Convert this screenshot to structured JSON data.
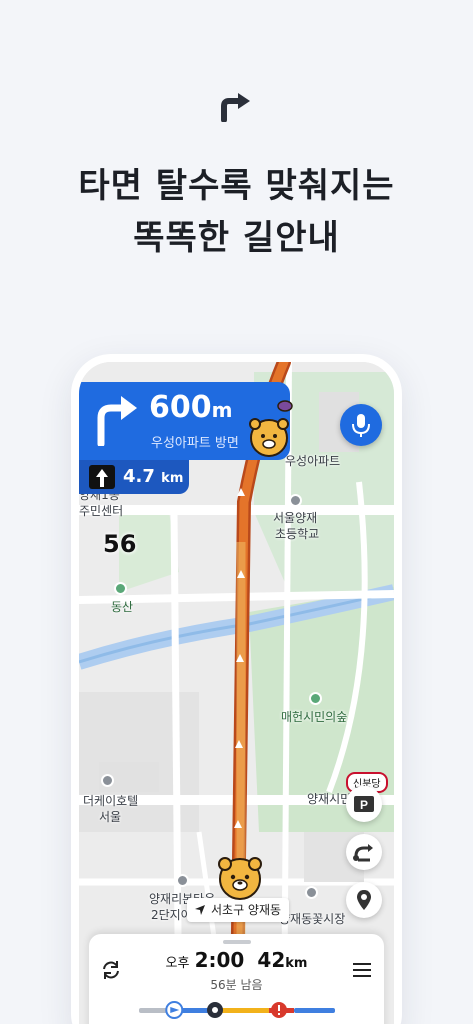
{
  "headline": {
    "line1": "타면 탈수록 맞춰지는",
    "line2": "똑똑한 길안내"
  },
  "navigation": {
    "distance_value": "600",
    "distance_unit": "m",
    "destination": "우성아파트 방면",
    "next_distance_value": "4.7",
    "next_distance_unit": "km",
    "speed_limit": "56"
  },
  "map_labels": {
    "apt": "우성아파트",
    "school_1": "서울양재",
    "school_2": "초등학교",
    "center_1": "양재1동",
    "center_2": "주민센터",
    "mountain": "동산",
    "forest": "매헌시민의숲",
    "hotel_1": "더케이호텔",
    "hotel_2": "서울",
    "station_area": "양재시민",
    "station_badge": "신분당",
    "apt2_1": "양재리본타운",
    "apt2_2": "2단지아",
    "market": "양재동꽃시장",
    "current_location": "서초구 양재동"
  },
  "trip": {
    "ampm": "오후",
    "arrival_time": "2:00",
    "distance_value": "42",
    "distance_unit": "km",
    "remaining": "56분 남음",
    "progress_fraction": 0.18
  },
  "colors": {
    "primary_blue": "#1f6be0",
    "route_orange": "#e4742a",
    "traffic_red": "#d8392c",
    "traffic_yellow": "#f2b21b",
    "traffic_blue": "#3f7fe0",
    "background": "#f3f5f9"
  },
  "icons": {
    "hero": "turn-right-arrow-icon",
    "mic": "microphone-icon",
    "parking": "parking-icon",
    "reroute": "reroute-icon",
    "pin": "location-pin-icon",
    "refresh": "refresh-icon",
    "menu": "hamburger-menu-icon"
  }
}
